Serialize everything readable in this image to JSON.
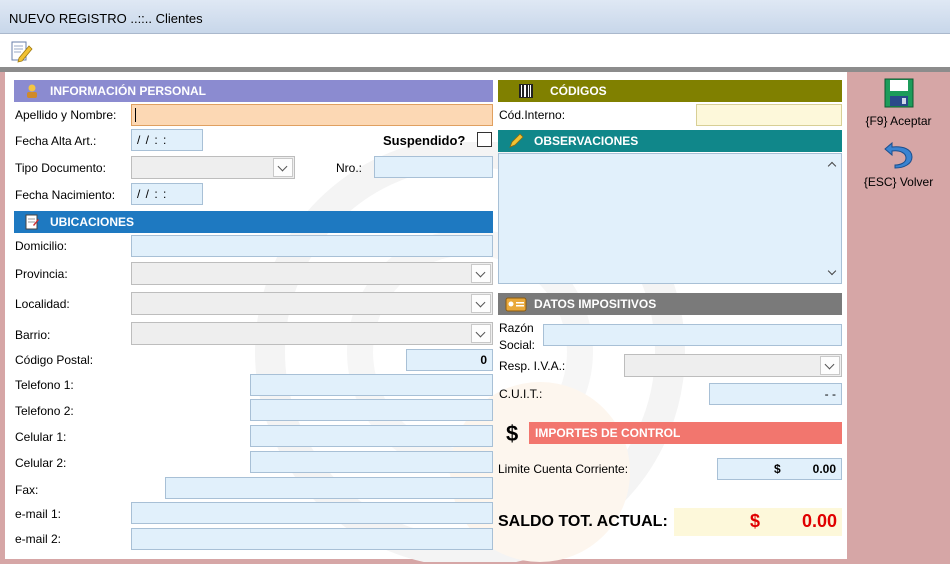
{
  "window": {
    "title": "NUEVO REGISTRO ..::.. Clientes"
  },
  "toolbar": {
    "icon": "edit-document-icon"
  },
  "side": {
    "accept_label": "{F9} Aceptar",
    "back_label": "{ESC} Volver"
  },
  "personal": {
    "header": "INFORMACIÓN PERSONAL",
    "apellido_label": "Apellido y Nombre:",
    "apellido_value": "",
    "fecha_alta_label": "Fecha Alta Art.:",
    "fecha_alta_value": "/ /     : :",
    "suspendido_label": "Suspendido?",
    "tipo_doc_label": "Tipo Documento:",
    "tipo_doc_value": "",
    "nro_label": "Nro.:",
    "nro_value": "",
    "fecha_nac_label": "Fecha Nacimiento:",
    "fecha_nac_value": "/ /     : :"
  },
  "ubicaciones": {
    "header": "UBICACIONES",
    "domicilio_label": "Domicilio:",
    "provincia_label": "Provincia:",
    "localidad_label": "Localidad:",
    "barrio_label": "Barrio:",
    "cp_label": "Código Postal:",
    "cp_value": "0",
    "tel1_label": "Telefono 1:",
    "tel2_label": "Telefono 2:",
    "cel1_label": "Celular 1:",
    "cel2_label": "Celular 2:",
    "fax_label": "Fax:",
    "email1_label": "e-mail 1:",
    "email2_label": "e-mail 2:"
  },
  "codigos": {
    "header": "CÓDIGOS",
    "cod_interno_label": "Cód.Interno:",
    "cod_interno_value": ""
  },
  "observaciones": {
    "header": "OBSERVACIONES",
    "value": ""
  },
  "impositivos": {
    "header": "DATOS IMPOSITIVOS",
    "razon_label_1": "Razón",
    "razon_label_2": "Social:",
    "resp_iva_label": "Resp. I.V.A.:",
    "cuit_label": "C.U.I.T.:",
    "cuit_value": "-      -"
  },
  "importes": {
    "header": "IMPORTES DE CONTROL",
    "limite_label": "Limite Cuenta Corriente:",
    "limite_currency": "$",
    "limite_value": "0.00"
  },
  "saldo": {
    "label": "SALDO TOT. ACTUAL:",
    "currency": "$",
    "value": "0.00"
  },
  "colors": {
    "header_personal": "#8b8bd0",
    "header_ubicaciones": "#1e79c1",
    "header_codigos": "#808000",
    "header_observaciones": "#10878a",
    "header_impositivos": "#7a7a7a",
    "header_importes": "#f2766e",
    "side_panel": "#d6a6a6",
    "saldo_red": "#e00000"
  }
}
